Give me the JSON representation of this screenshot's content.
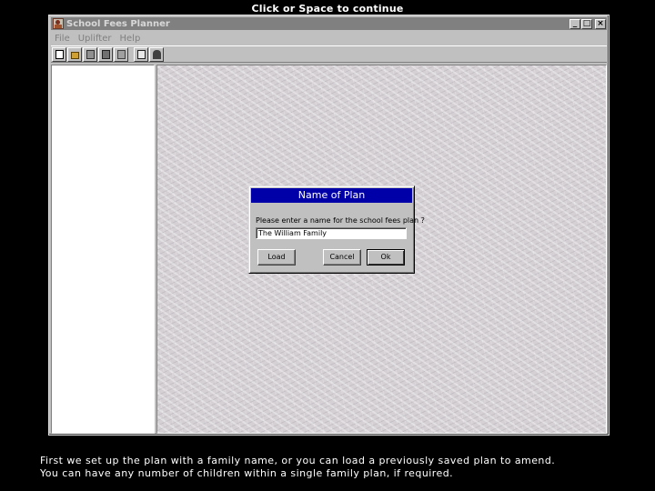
{
  "hint": "Click or Space to continue",
  "window": {
    "title": "School Fees Planner",
    "controls": {
      "minimize": "_",
      "maximize": "□",
      "close": "×"
    }
  },
  "menu": [
    "File",
    "Uplifter",
    "Help"
  ],
  "toolbar": [
    {
      "name": "new-file",
      "icon": "page-icon"
    },
    {
      "name": "open",
      "icon": "folder-icon"
    },
    {
      "name": "print-setup",
      "icon": "printer-icon"
    },
    {
      "name": "save",
      "icon": "disk-icon"
    },
    {
      "name": "print",
      "icon": "printer-icon"
    },
    {
      "name": "help",
      "icon": "book-icon"
    },
    {
      "name": "exit",
      "icon": "door-icon"
    }
  ],
  "dialog": {
    "title": "Name of Plan",
    "prompt": "Please enter a name for the school fees plan ?",
    "value": "The William Family",
    "buttons": {
      "load": "Load",
      "cancel": "Cancel",
      "ok": "Ok"
    }
  },
  "caption": {
    "line1": "First we set up the plan with a family name, or you can load a previously saved plan to amend.",
    "line2": "You can have any number of children within a single family plan, if required."
  },
  "colors": {
    "dialog_title_bar": "#0000a8",
    "inactive_title_bar": "#808080",
    "background": "#000000"
  }
}
